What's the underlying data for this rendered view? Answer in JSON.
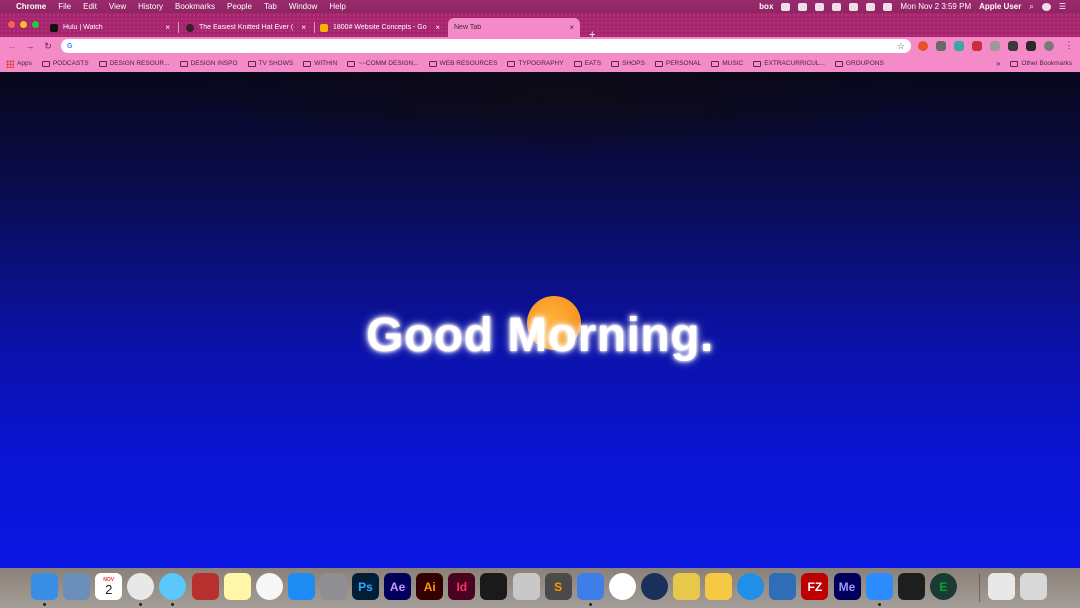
{
  "menubar": {
    "app_name": "Chrome",
    "menus": [
      "File",
      "Edit",
      "View",
      "History",
      "Bookmarks",
      "People",
      "Tab",
      "Window",
      "Help"
    ],
    "status_app": "box",
    "clock": "Mon Nov 2  3:59 PM",
    "user": "Apple User"
  },
  "tabs": [
    {
      "title": "Hulu | Watch",
      "favicon_color": "#1ce783"
    },
    {
      "title": "The Easiest Knitted Hat Ever (",
      "favicon_color": "#333333"
    },
    {
      "title": "1800# Website Concepts - Go",
      "favicon_color": "#f4b400"
    },
    {
      "title": "New Tab",
      "favicon_color": ""
    }
  ],
  "omnibox": {
    "icon": "G",
    "value": ""
  },
  "bookmarks": {
    "apps_label": "Apps",
    "folders": [
      "PODCASTS",
      "DESIGN RESOUR...",
      "DESIGN INSPO",
      "TV SHOWS",
      "WITHIN",
      "~~COMM DESIGN...",
      "WEB RESOURCES",
      "TYPOGRAPHY",
      "EATS",
      "SHOPS",
      "PERSONAL",
      "MUSIC",
      "EXTRACURRICUL...",
      "GROUPONS"
    ],
    "overflow": "»",
    "other_label": "Other Bookmarks"
  },
  "page": {
    "greeting": "Good Morning."
  },
  "dock": {
    "calendar_day": "2",
    "calendar_month": "NOV",
    "apps": [
      {
        "name": "finder",
        "label": "",
        "color": "#3a8ee6"
      },
      {
        "name": "preview",
        "label": "",
        "color": "#6a8fb8"
      },
      {
        "name": "calendar",
        "label": "2",
        "color": "#ffffff"
      },
      {
        "name": "chrome",
        "label": "",
        "color": "#e8e8e8"
      },
      {
        "name": "messages",
        "label": "",
        "color": "#5ac8fa"
      },
      {
        "name": "photo-booth",
        "label": "",
        "color": "#b8302c"
      },
      {
        "name": "notes",
        "label": "",
        "color": "#fff6a8"
      },
      {
        "name": "music",
        "label": "",
        "color": "#f6f6f6"
      },
      {
        "name": "app-store",
        "label": "",
        "color": "#1d8df5"
      },
      {
        "name": "system-preferences",
        "label": "",
        "color": "#8e8e93"
      },
      {
        "name": "photoshop",
        "label": "Ps",
        "color": "#001e36"
      },
      {
        "name": "after-effects",
        "label": "Ae",
        "color": "#00005b"
      },
      {
        "name": "illustrator",
        "label": "Ai",
        "color": "#330000"
      },
      {
        "name": "indesign",
        "label": "Id",
        "color": "#49021f"
      },
      {
        "name": "acrobat",
        "label": "",
        "color": "#1a1a1a"
      },
      {
        "name": "disk-utility",
        "label": "",
        "color": "#c8c8c8"
      },
      {
        "name": "sublime-text",
        "label": "S",
        "color": "#4a4a4a"
      },
      {
        "name": "spark",
        "label": "",
        "color": "#3f7ee8"
      },
      {
        "name": "slack",
        "label": "",
        "color": "#ffffff"
      },
      {
        "name": "cinema4d",
        "label": "",
        "color": "#1a2f5a"
      },
      {
        "name": "super-mario",
        "label": "",
        "color": "#e8c84a"
      },
      {
        "name": "cyberduck",
        "label": "",
        "color": "#f6c945"
      },
      {
        "name": "safari",
        "label": "",
        "color": "#1f8fe8"
      },
      {
        "name": "transmit",
        "label": "",
        "color": "#2f6db8"
      },
      {
        "name": "filezilla",
        "label": "FZ",
        "color": "#bf0000"
      },
      {
        "name": "media-encoder",
        "label": "Me",
        "color": "#00005b"
      },
      {
        "name": "zoom",
        "label": "",
        "color": "#2d8cff"
      },
      {
        "name": "figma",
        "label": "",
        "color": "#1e1e1e"
      },
      {
        "name": "evernote",
        "label": "E",
        "color": "#1b3a34"
      },
      {
        "name": "documents",
        "label": "",
        "color": "#e8e8e8"
      },
      {
        "name": "trash",
        "label": "",
        "color": "#d8d8d8"
      }
    ]
  }
}
